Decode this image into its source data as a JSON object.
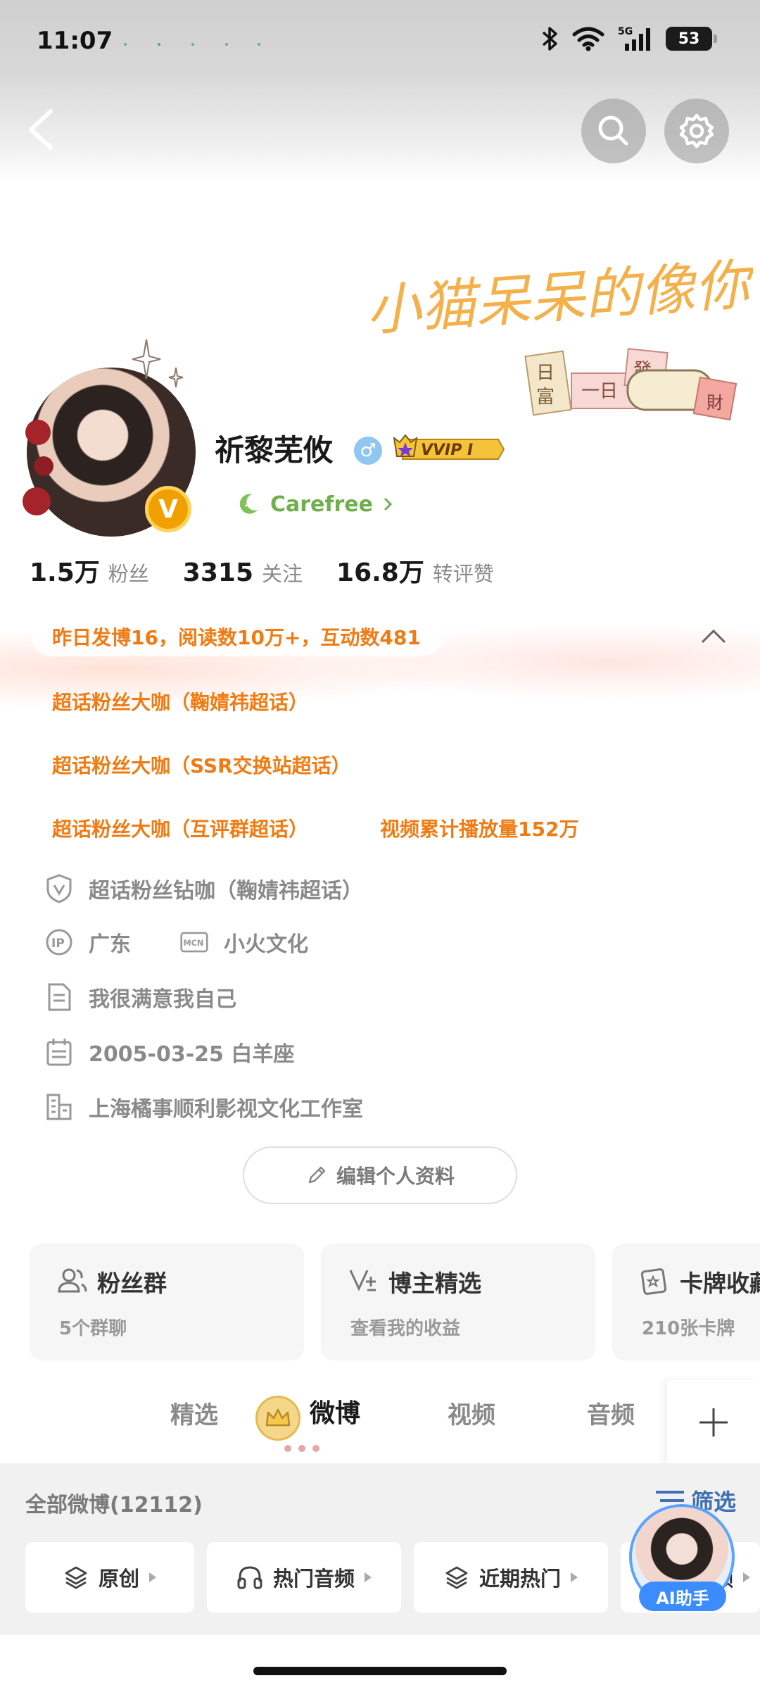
{
  "status_bar": {
    "time": "11:07",
    "network": "5G",
    "battery": "53"
  },
  "banner": {
    "script_text": "小猫呆呆的像你",
    "tags": [
      "日",
      "富",
      "一日",
      "發",
      "財"
    ]
  },
  "profile": {
    "username": "祈黎芜攸",
    "gender_symbol": "♂",
    "vip_badge": "VVIP I",
    "verified_badge": "V",
    "mood": "Carefree"
  },
  "stats": [
    {
      "value": "1.5万",
      "label": "粉丝"
    },
    {
      "value": "3315",
      "label": "关注"
    },
    {
      "value": "16.8万",
      "label": "转评赞"
    }
  ],
  "highlight": "昨日发博16，阅读数10万+，互动数481",
  "honors": [
    "超话粉丝大咖（鞠婧祎超话）",
    "超话粉丝大咖（SSR交换站超话）",
    "超话粉丝大咖（互评群超话）",
    "视频累计播放量152万"
  ],
  "info": {
    "super_topic": "超话粉丝钻咖（鞠婧祎超话）",
    "ip": "广东",
    "mcn": "小火文化",
    "bio": "我很满意我自己",
    "birthday": "2005-03-25 白羊座",
    "company": "上海橘事顺利影视文化工作室"
  },
  "edit_button": "编辑个人资料",
  "cards": [
    {
      "title": "粉丝群",
      "subtitle": "5个群聊"
    },
    {
      "title": "博主精选",
      "subtitle": "查看我的收益"
    },
    {
      "title": "卡牌收藏",
      "subtitle": "210张卡牌"
    }
  ],
  "tabs": [
    "精选",
    "微博",
    "视频",
    "音频"
  ],
  "active_tab": "微博",
  "feed": {
    "count_label": "全部微博(12112)",
    "filter_label": "筛选",
    "chips": [
      "原创",
      "热门音频",
      "近期热门",
      "视频"
    ]
  },
  "ai_assistant": {
    "label": "AI助手"
  },
  "colors": {
    "accent_orange": "#f07b12",
    "link_blue": "#3f6fb5",
    "ai_blue": "#3a8cff",
    "mood_green": "#6fb04d"
  }
}
